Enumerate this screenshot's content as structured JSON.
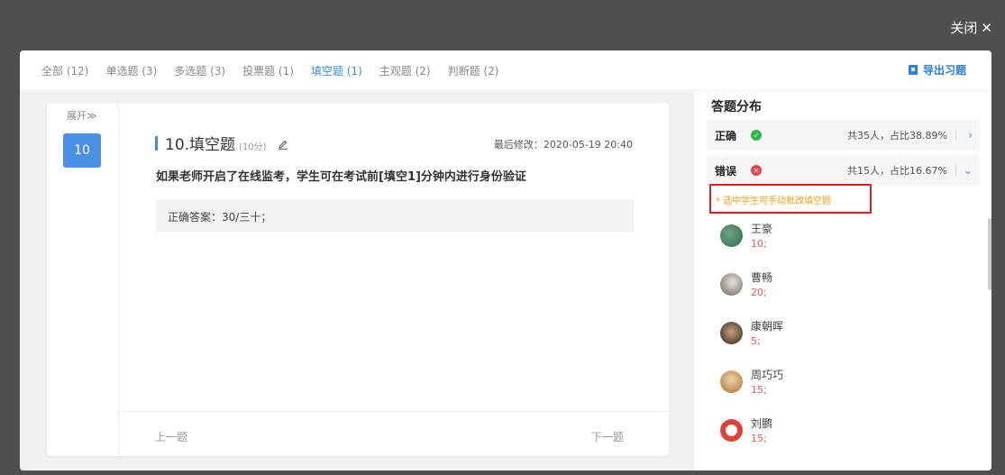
{
  "header": {
    "close_label": "关闭",
    "close_glyph": "✕"
  },
  "tabs": [
    {
      "label": "全部 (12)",
      "active": false
    },
    {
      "label": "单选题 (3)",
      "active": false
    },
    {
      "label": "多选题 (3)",
      "active": false
    },
    {
      "label": "投票题 (1)",
      "active": false
    },
    {
      "label": "填空题 (1)",
      "active": true
    },
    {
      "label": "主观题 (2)",
      "active": false
    },
    {
      "label": "判断题 (2)",
      "active": false
    }
  ],
  "export_label": "导出习题",
  "question": {
    "expand_label": "展开≫",
    "number": "10",
    "title": "10.填空题",
    "score": "(10分)",
    "modified": "最后修改：2020-05-19 20:40",
    "text": "如果老师开启了在线监考，学生可在考试前[填空1]分钟内进行身份验证",
    "answer": "正确答案：30/三十；",
    "prev_label": "上一题",
    "next_label": "下一题"
  },
  "distribution": {
    "title": "答题分布",
    "correct": {
      "label": "正确",
      "count": "共35人，占比38.89%",
      "color": "#2db84c"
    },
    "wrong": {
      "label": "错误",
      "count": "共15人，占比16.67%",
      "color": "#e8434b"
    },
    "hint": "* 选中学生可手动批改填空题",
    "students": [
      {
        "name": "王豪",
        "score": "10;",
        "avatar_color": "#2f6e4f"
      },
      {
        "name": "曹畅",
        "score": "20;",
        "avatar_color": "#9a8f89"
      },
      {
        "name": "康朝晖",
        "score": "5;",
        "avatar_color": "#3a332c"
      },
      {
        "name": "周巧巧",
        "score": "15;",
        "avatar_color": "#b68c5a"
      },
      {
        "name": "刘鹏",
        "score": "15;",
        "avatar_color": "#d9453f"
      }
    ]
  },
  "colors": {
    "accent": "#3c8be8",
    "highlight_border": "#e02020",
    "hint_text": "#f39c12"
  }
}
